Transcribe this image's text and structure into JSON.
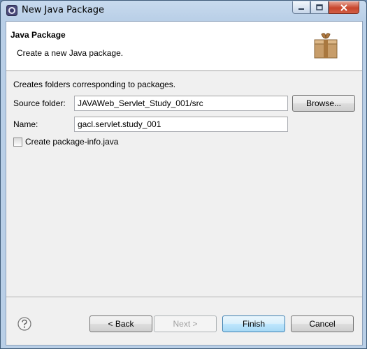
{
  "window": {
    "title": "New Java Package"
  },
  "banner": {
    "title": "Java Package",
    "description": "Create a new Java package."
  },
  "form": {
    "intro": "Creates folders corresponding to packages.",
    "source_folder_label": "Source folder:",
    "source_folder_value": "JAVAWeb_Servlet_Study_001/src",
    "browse_label": "Browse...",
    "name_label": "Name:",
    "name_value": "gacl.servlet.study_001",
    "create_package_info_label": "Create package-info.java",
    "create_package_info_checked": false
  },
  "footer": {
    "back_label": "< Back",
    "next_label": "Next >",
    "finish_label": "Finish",
    "cancel_label": "Cancel"
  }
}
